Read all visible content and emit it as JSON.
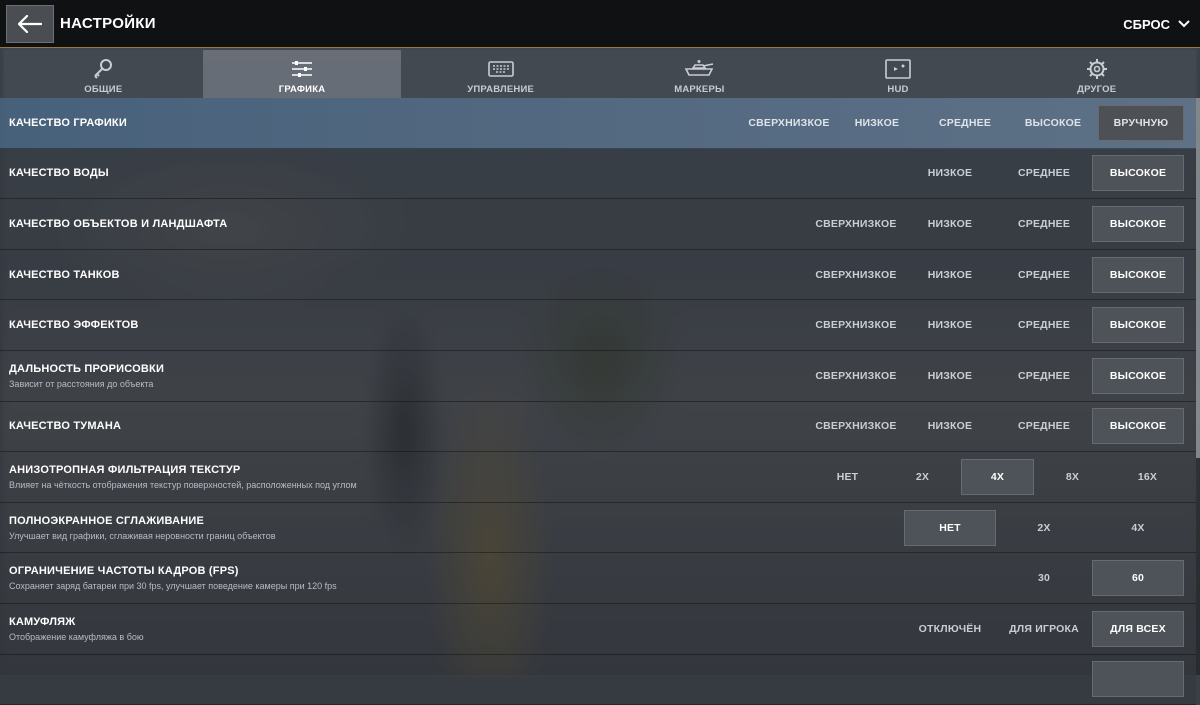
{
  "header": {
    "title": "НАСТРОЙКИ",
    "reset_label": "СБРОС"
  },
  "tabs": [
    {
      "label": "ОБЩИЕ",
      "icon": "key-icon",
      "active": false
    },
    {
      "label": "ГРАФИКА",
      "icon": "sliders-icon",
      "active": true
    },
    {
      "label": "УПРАВЛЕНИЕ",
      "icon": "keyboard-icon",
      "active": false
    },
    {
      "label": "МАРКЕРЫ",
      "icon": "tank-icon",
      "active": false
    },
    {
      "label": "HUD",
      "icon": "minimap-icon",
      "active": false
    },
    {
      "label": "ДРУГОЕ",
      "icon": "gear-icon",
      "active": false
    }
  ],
  "settings": [
    {
      "title": "КАЧЕСТВО ГРАФИКИ",
      "subtitle": "",
      "options": [
        "СВЕРХНИЗКОЕ",
        "НИЗКОЕ",
        "СРЕДНЕЕ",
        "ВЫСОКОЕ",
        "ВРУЧНУЮ"
      ],
      "selected": 4
    },
    {
      "title": "КАЧЕСТВО ВОДЫ",
      "subtitle": "",
      "options": [
        "НИЗКОЕ",
        "СРЕДНЕЕ",
        "ВЫСОКОЕ"
      ],
      "selected": 2
    },
    {
      "title": "КАЧЕСТВО ОБЪЕКТОВ И ЛАНДШАФТА",
      "subtitle": "",
      "options": [
        "СВЕРХНИЗКОЕ",
        "НИЗКОЕ",
        "СРЕДНЕЕ",
        "ВЫСОКОЕ"
      ],
      "selected": 3
    },
    {
      "title": "КАЧЕСТВО ТАНКОВ",
      "subtitle": "",
      "options": [
        "СВЕРХНИЗКОЕ",
        "НИЗКОЕ",
        "СРЕДНЕЕ",
        "ВЫСОКОЕ"
      ],
      "selected": 3
    },
    {
      "title": "КАЧЕСТВО ЭФФЕКТОВ",
      "subtitle": "",
      "options": [
        "СВЕРХНИЗКОЕ",
        "НИЗКОЕ",
        "СРЕДНЕЕ",
        "ВЫСОКОЕ"
      ],
      "selected": 3
    },
    {
      "title": "ДАЛЬНОСТЬ ПРОРИСОВКИ",
      "subtitle": "Зависит от расстояния до объекта",
      "options": [
        "СВЕРХНИЗКОЕ",
        "НИЗКОЕ",
        "СРЕДНЕЕ",
        "ВЫСОКОЕ"
      ],
      "selected": 3
    },
    {
      "title": "КАЧЕСТВО ТУМАНА",
      "subtitle": "",
      "options": [
        "СВЕРХНИЗКОЕ",
        "НИЗКОЕ",
        "СРЕДНЕЕ",
        "ВЫСОКОЕ"
      ],
      "selected": 3
    },
    {
      "title": "АНИЗОТРОПНАЯ ФИЛЬТРАЦИЯ ТЕКСТУР",
      "subtitle": "Влияет на чёткость отображения текстур поверхностей, расположенных под углом",
      "options": [
        "НЕТ",
        "2X",
        "4X",
        "8X",
        "16X"
      ],
      "selected": 2
    },
    {
      "title": "ПОЛНОЭКРАННОЕ СГЛАЖИВАНИЕ",
      "subtitle": "Улучшает вид графики, сглаживая неровности границ объектов",
      "options": [
        "НЕТ",
        "2X",
        "4X"
      ],
      "selected": 0
    },
    {
      "title": "ОГРАНИЧЕНИЕ ЧАСТОТЫ КАДРОВ (FPS)",
      "subtitle": "Сохраняет заряд батареи при 30 fps, улучшает поведение камеры при 120 fps",
      "options": [
        "30",
        "60"
      ],
      "selected": 1
    },
    {
      "title": "КАМУФЛЯЖ",
      "subtitle": "Отображение камуфляжа в бою",
      "options": [
        "ОТКЛЮЧЁН",
        "ДЛЯ ИГРОКА",
        "ДЛЯ ВСЕХ"
      ],
      "selected": 2
    },
    {
      "title": "",
      "subtitle": "",
      "options": [
        ""
      ],
      "selected": 0
    }
  ]
}
